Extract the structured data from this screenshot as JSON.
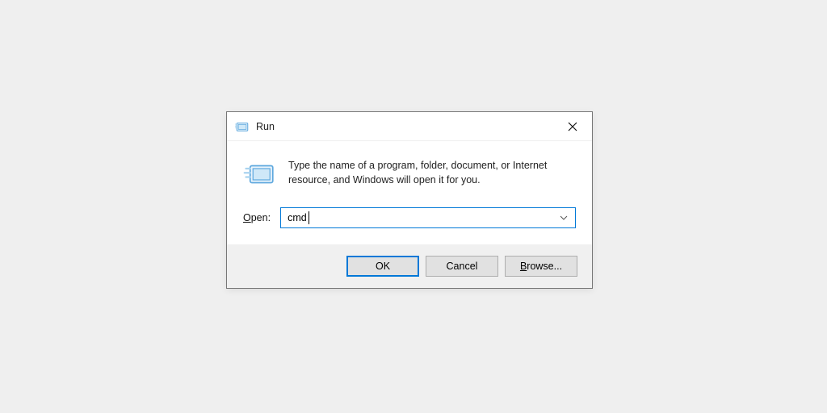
{
  "dialog": {
    "title": "Run",
    "description": "Type the name of a program, folder, document, or Internet resource, and Windows will open it for you.",
    "open_label_prefix": "O",
    "open_label_rest": "pen:",
    "input_value": "cmd",
    "buttons": {
      "ok": "OK",
      "cancel": "Cancel",
      "browse_prefix": "B",
      "browse_rest": "rowse..."
    }
  }
}
